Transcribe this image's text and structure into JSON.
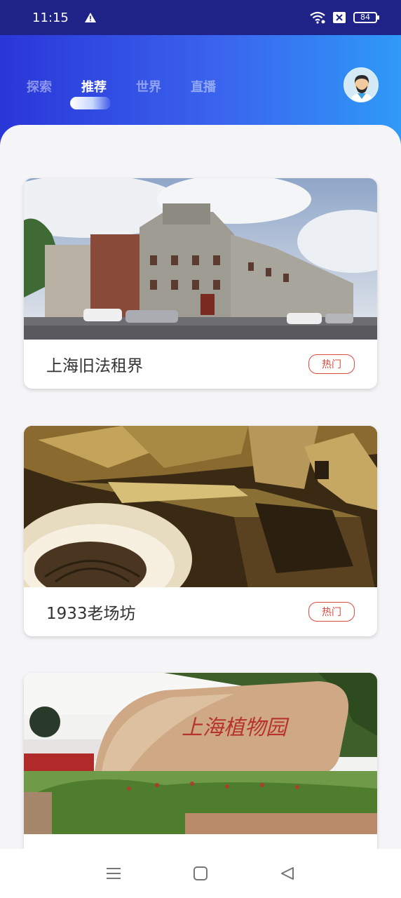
{
  "status_bar": {
    "time": "11:15",
    "battery": "84",
    "icons": [
      "warning-icon",
      "wifi-icon",
      "sim-off-icon",
      "battery-icon"
    ]
  },
  "tabs": [
    {
      "label": "探索",
      "active": false
    },
    {
      "label": "推荐",
      "active": true
    },
    {
      "label": "世界",
      "active": false
    },
    {
      "label": "直播",
      "active": false
    }
  ],
  "avatar": {
    "icon": "user-avatar-icon"
  },
  "cards": [
    {
      "title": "上海旧法租界",
      "badge": "热门",
      "image": "stone-buildings-street-photo"
    },
    {
      "title": "1933老场坊",
      "badge": "热门",
      "image": "concrete-architecture-interior-photo"
    },
    {
      "title": "",
      "badge": "",
      "image": "botanical-garden-stone-photo",
      "stone_text": "上海植物园"
    }
  ],
  "nav_bar": {
    "icons": [
      "menu-icon",
      "home-square-icon",
      "back-triangle-icon"
    ]
  },
  "colors": {
    "status_bar": "#1f2287",
    "header_start": "#2a36d8",
    "header_end": "#2f9af7",
    "badge": "#d94a3f",
    "background": "#f5f5f7"
  }
}
